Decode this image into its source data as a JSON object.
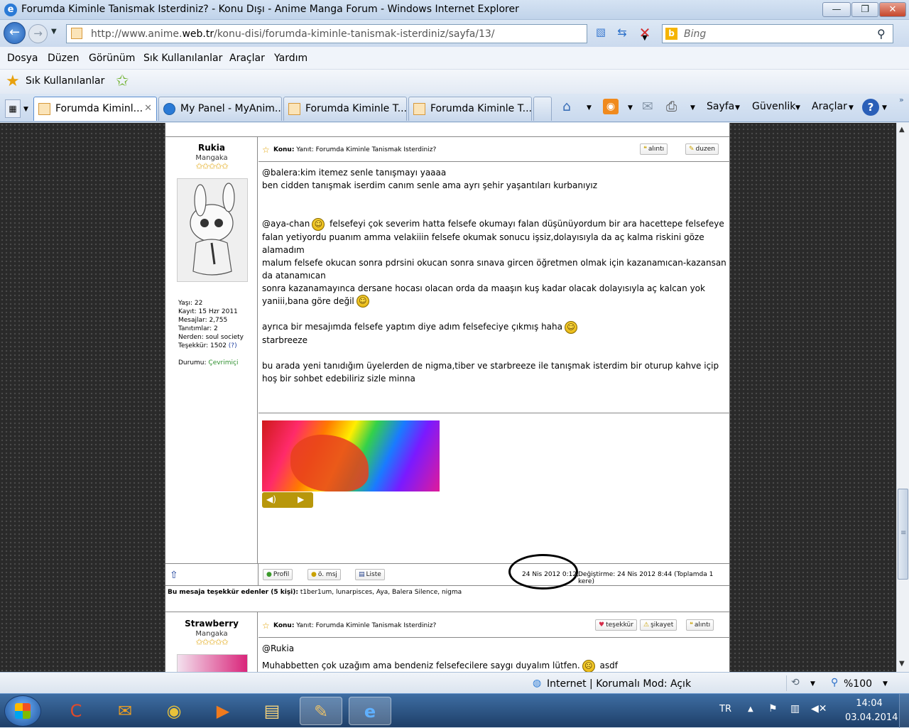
{
  "window": {
    "title": "Forumda Kiminle Tanismak Isterdiniz? - Konu Dışı - Anime Manga Forum - Windows Internet Explorer",
    "min_label": "—",
    "max_label": "❐",
    "close_label": "✕"
  },
  "address": {
    "url_prefix": "http://www.anime.",
    "url_domain": "web.tr",
    "url_rest": "/konu-disi/forumda-kiminle-tanismak-isterdiniz/sayfa/13/",
    "search_placeholder": "Bing"
  },
  "menu": [
    "Dosya",
    "Düzen",
    "Görünüm",
    "Sık Kullanılanlar",
    "Araçlar",
    "Yardım"
  ],
  "favorites": {
    "label": "Sık Kullanılanlar"
  },
  "tabs": [
    {
      "label": "Forumda Kiminl...",
      "close": "✕"
    },
    {
      "label": "My Panel - MyAnim..."
    },
    {
      "label": "Forumda Kiminle T..."
    },
    {
      "label": "Forumda Kiminle T..."
    }
  ],
  "toolbar": {
    "page": "Sayfa",
    "security": "Güvenlik",
    "tools": "Araçlar"
  },
  "post1": {
    "username": "Rukia",
    "rank": "Mangaka",
    "stars": "✩✩✩✩✩",
    "info": [
      "Yaşı: 22",
      "Kayıt: 15 Hzr 2011",
      "Mesajlar: 2,755",
      "Tanıtımlar: 2",
      "Nerden: soul society"
    ],
    "thanks_label": "Teşekkür: 1502 ",
    "thanks_q": "(?)",
    "status_label": "Durumu: ",
    "status_value": "Çevrimiçi",
    "subject_prefix": "Konu:",
    "subject": " Yanıt: Forumda Kiminle Tanismak Isterdiniz?",
    "btn_quote": "alıntı",
    "btn_edit": "duzen",
    "lines": [
      "@balera:kim itemez senle tanışmayı yaaaa",
      "ben cidden tanışmak iserdim canım senle ama ayrı şehir yaşantıları kurbanıyız",
      "",
      "",
      "@aya-chan",
      " felsefeyi çok severim hatta felsefe okumayı falan düşünüyordum bir ara hacettepe felsefeye falan yetiyordu puanım amma velakiiin felsefe okumak sonucu işsiz,dolayısıyla da aç kalma riskini göze alamadım",
      "malum felsefe okucan sonra pdrsini okucan sonra sınava gircen öğretmen olmak için kazanamıcan-kazansan da atanamıcan",
      "sonra kazanamayınca dersane hocası olacan orda da maaşın kuş kadar olacak dolayısıyla aç kalcan yok yaniii,bana göre değil",
      "ayrıca bir mesajımda felsefe yaptım diye adım felsefeciye çıkmış haha",
      "starbreeze",
      "bu arada yeni tanıdığım üyelerden de nigma,tiber ve starbreeze ile tanışmak isterdim bir oturup kahve içip hoş bir sohbet edebiliriz sizle minna"
    ],
    "footer": {
      "profile": "Profil",
      "pm": "ö. msj",
      "list": "Liste",
      "date": "24 Nis 2012 0:12,",
      "edited": " Değiştirme: 24 Nis 2012 8:44 (Toplamda 1 kere)"
    },
    "thanks_row_label": "Bu mesaja teşekkür edenler (5 kişi):",
    "thanks_row_names": " t1ber1um, lunarpisces, Aya, Balera Silence, nigma"
  },
  "post2": {
    "username": "Strawberry",
    "rank": "Mangaka",
    "stars": "✩✩✩✩✩",
    "subject_prefix": "Konu:",
    "subject": " Yanıt: Forumda Kiminle Tanismak Isterdiniz?",
    "btn_thanks": "teşekkür",
    "btn_report": "şikayet",
    "btn_quote": "alıntı",
    "line1": "@Rukia",
    "line2": "Muhabbetten çok uzağım ama bendeniz felsefecilere saygı duyalım lütfen.",
    "line2_end": " asdf"
  },
  "status": {
    "zone": "Internet | Korumalı Mod: Açık",
    "zoom": "%100"
  },
  "tray": {
    "lang": "TR",
    "time": "14:04",
    "date": "03.04.2014"
  }
}
